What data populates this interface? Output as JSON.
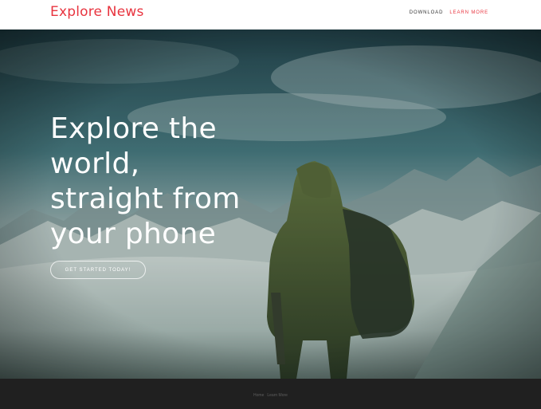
{
  "navbar": {
    "brand": "Explore News",
    "links": [
      "DOWNLOAD",
      "LEARN MORE"
    ]
  },
  "hero": {
    "headline_lines": [
      "Explore the",
      "world,",
      "straight from",
      "your phone"
    ],
    "cta_label": "GET STARTED TODAY!"
  },
  "footer": {
    "links": [
      "Home",
      "Learn More"
    ]
  },
  "colors": {
    "brand": "#e8343f",
    "footer_bg": "#202020",
    "nav_bg": "#ffffff"
  }
}
